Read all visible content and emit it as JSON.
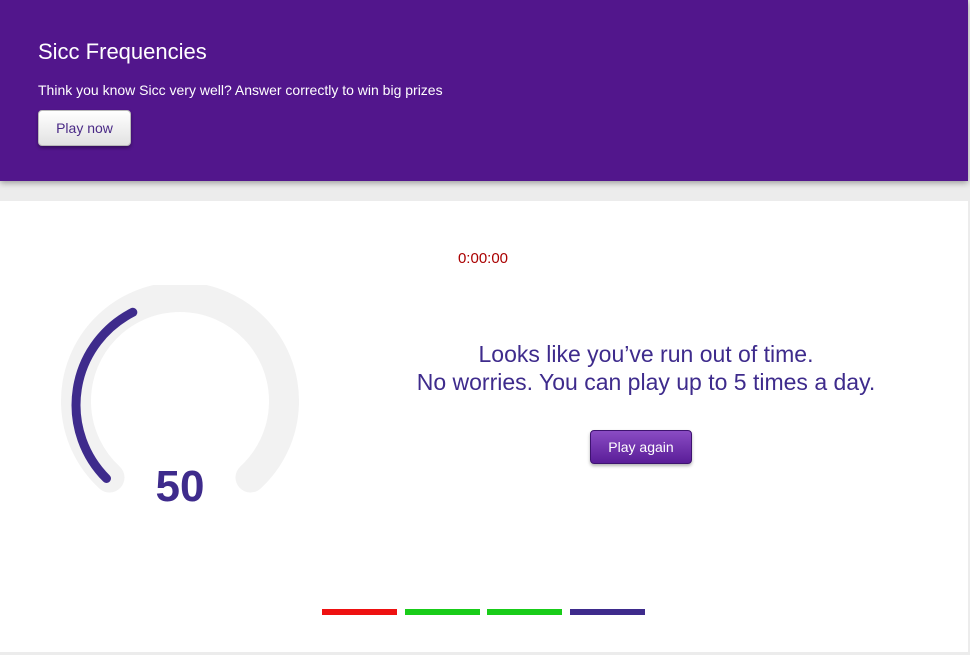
{
  "hero": {
    "title": "Sicc Frequencies",
    "subtitle": "Think you know Sicc very well? Answer correctly to win big prizes",
    "play_now_label": "Play now"
  },
  "game": {
    "timer": "0:00:00",
    "score": "50",
    "score_gauge_fraction": 0.4,
    "message_line1": "Looks like you’ve run out of time.",
    "message_line2": "No worries. You can play up to 5 times a day.",
    "play_again_label": "Play again",
    "progress_segments": [
      {
        "status": "wrong",
        "color": "#ee1111"
      },
      {
        "status": "correct",
        "color": "#19cc19"
      },
      {
        "status": "correct",
        "color": "#19cc19"
      },
      {
        "status": "current",
        "color": "#3e2b8c"
      }
    ]
  },
  "colors": {
    "brand": "#52168c",
    "accent": "#3e2b8c",
    "timer": "#aa0000",
    "gauge_track": "#f2f2f2"
  }
}
